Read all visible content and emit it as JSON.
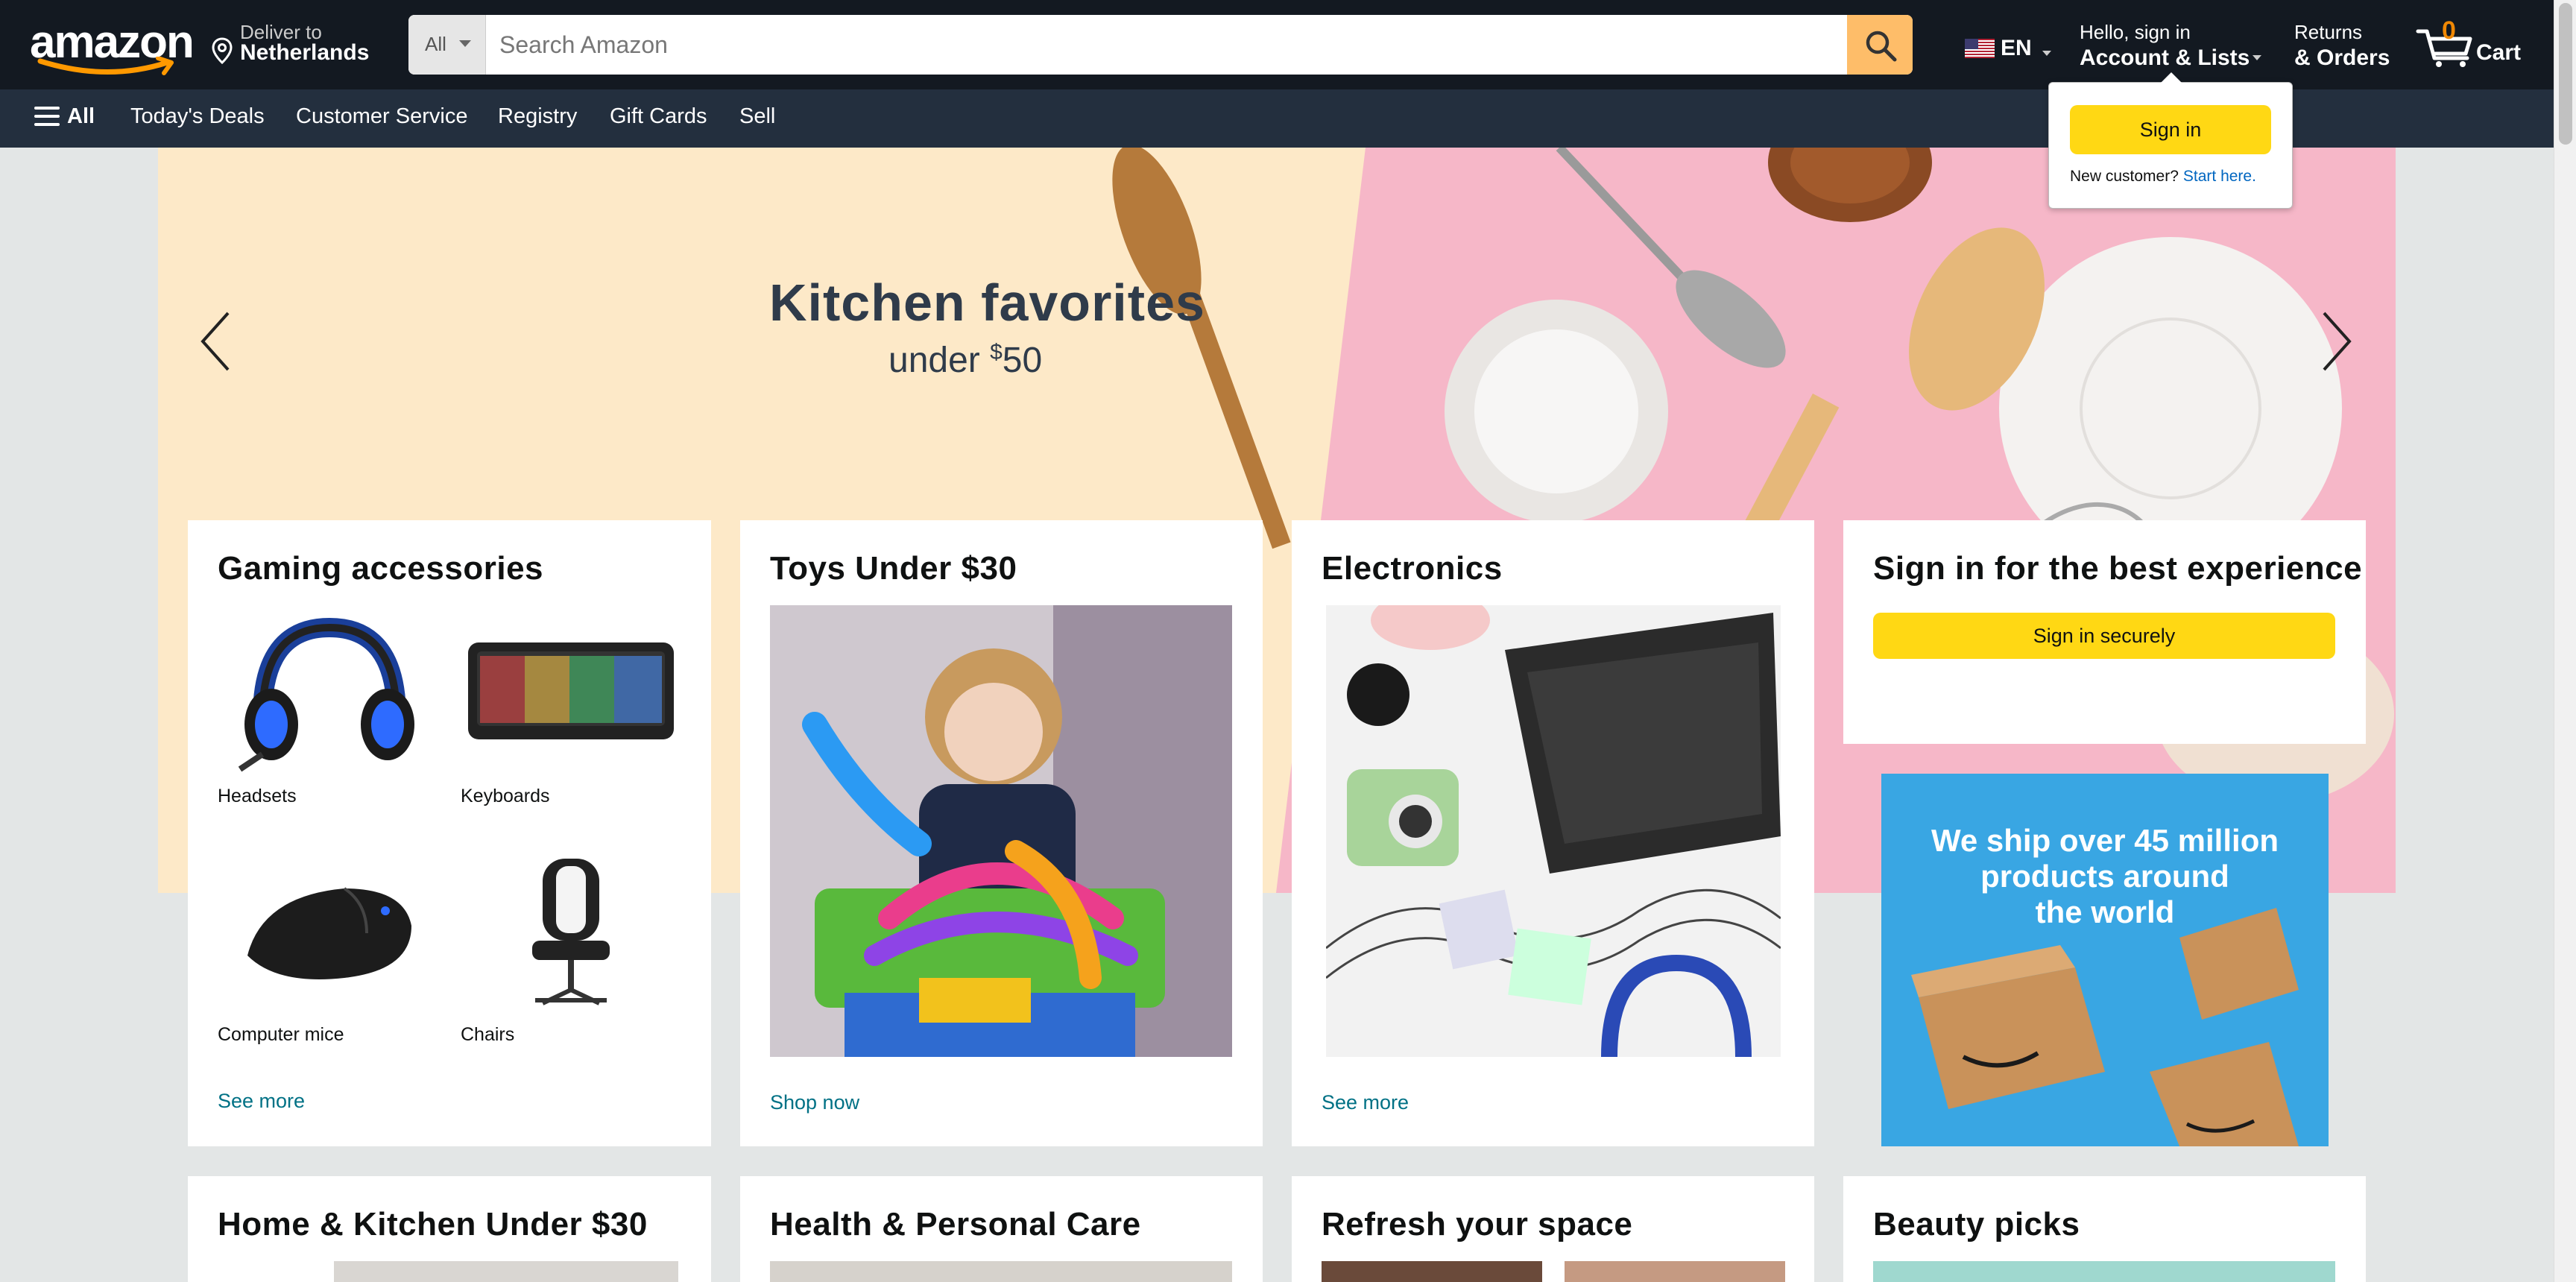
{
  "header": {
    "logo_text": "amazon",
    "deliver_line1": "Deliver to",
    "deliver_line2": "Netherlands",
    "search_category": "All",
    "search_placeholder": "Search Amazon",
    "language": "EN",
    "account_line1": "Hello, sign in",
    "account_line2": "Account & Lists",
    "returns_line1": "Returns",
    "returns_line2": "& Orders",
    "cart_count": "0",
    "cart_label": "Cart"
  },
  "subnav": {
    "all_label": "All",
    "items": [
      "Today's Deals",
      "Customer Service",
      "Registry",
      "Gift Cards",
      "Sell"
    ]
  },
  "flyout": {
    "sign_in_label": "Sign in",
    "new_customer_text": "New customer?",
    "start_here_label": "Start here."
  },
  "hero": {
    "title": "Kitchen favorites",
    "subtitle_prefix": "under ",
    "subtitle_currency": "$",
    "subtitle_amount": "50"
  },
  "cards": {
    "gaming": {
      "title": "Gaming accessories",
      "items": [
        {
          "label": "Headsets",
          "icon": "headset-image"
        },
        {
          "label": "Keyboards",
          "icon": "keyboard-image"
        },
        {
          "label": "Computer mice",
          "icon": "mouse-image"
        },
        {
          "label": "Chairs",
          "icon": "chair-image"
        }
      ],
      "link": "See more"
    },
    "toys": {
      "title": "Toys Under $30",
      "link": "Shop now"
    },
    "electronics": {
      "title": "Electronics",
      "link": "See more"
    },
    "signin": {
      "title": "Sign in for the best experience",
      "button": "Sign in securely"
    },
    "ship_ad": {
      "line1": "We ship over 45 million",
      "line2": "products around",
      "line3": "the world"
    },
    "row2": [
      {
        "title": "Home & Kitchen Under $30"
      },
      {
        "title": "Health & Personal Care"
      },
      {
        "title": "Refresh your space"
      },
      {
        "title": "Beauty picks"
      }
    ]
  },
  "colors": {
    "nav_dark": "#131921",
    "nav_sub": "#232f3e",
    "accent_orange": "#febd69",
    "button_yellow": "#ffd814",
    "link_teal": "#007185",
    "cart_orange": "#f08804"
  }
}
